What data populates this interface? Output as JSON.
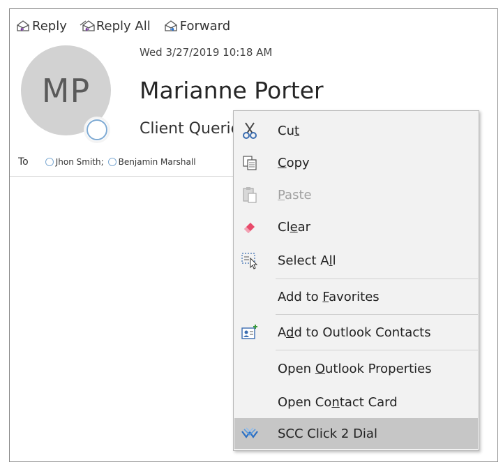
{
  "toolbar": {
    "reply": "Reply",
    "reply_all": "Reply All",
    "forward": "Forward"
  },
  "message": {
    "date": "Wed 3/27/2019 10:18 AM",
    "initials": "MP",
    "sender": "Marianne Porter",
    "subject": "Client Queries",
    "to_label": "To",
    "recipients": [
      "Jhon Smith;",
      "Benjamin Marshall"
    ]
  },
  "menu": {
    "items": [
      {
        "pre": "Cu",
        "key": "t",
        "post": "",
        "icon": "scissors-icon",
        "disabled": false
      },
      {
        "pre": "",
        "key": "C",
        "post": "opy",
        "icon": "copy-icon",
        "disabled": false
      },
      {
        "pre": "",
        "key": "P",
        "post": "aste",
        "icon": "paste-icon",
        "disabled": true
      },
      {
        "pre": "Cl",
        "key": "e",
        "post": "ar",
        "icon": "eraser-icon",
        "disabled": false
      },
      {
        "pre": "Select A",
        "key": "l",
        "post": "l",
        "icon": "select-all-icon",
        "disabled": false
      },
      {
        "pre": "Add to ",
        "key": "F",
        "post": "avorites",
        "icon": "",
        "disabled": false
      },
      {
        "pre": "A",
        "key": "d",
        "post": "d to Outlook Contacts",
        "icon": "add-contact-icon",
        "disabled": false
      },
      {
        "pre": "Open ",
        "key": "O",
        "post": "utlook Properties",
        "icon": "",
        "disabled": false
      },
      {
        "pre": "Open Co",
        "key": "n",
        "post": "tact Card",
        "icon": "",
        "disabled": false
      },
      {
        "pre": "SCC Click 2 Dial",
        "key": "",
        "post": "",
        "icon": "scc-dial-icon",
        "disabled": false
      }
    ]
  },
  "colors": {
    "menu_bg": "#f2f2f2",
    "highlight": "#c6c6c6",
    "avatar_bg": "#d2d2d2",
    "presence_ring": "#7eaad3",
    "accent_purple": "#7a3ea0",
    "accent_blue": "#2a6fc4"
  }
}
